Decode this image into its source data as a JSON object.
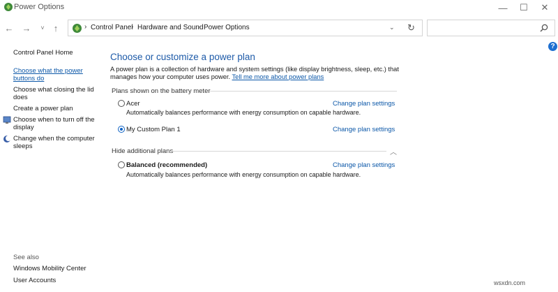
{
  "window": {
    "title": "Power Options",
    "minimize": "—",
    "maximize": "☐",
    "close": "✕"
  },
  "nav": {
    "back": "←",
    "forward": "→",
    "recent": "˅",
    "up": "↑"
  },
  "address": {
    "crumbs": [
      "Control Panel",
      "Hardware and Sound",
      "Power Options"
    ],
    "separator": "›",
    "dropdown": "⌄",
    "refresh": "↻"
  },
  "search": {
    "placeholder": ""
  },
  "help": "?",
  "left_pane": {
    "home": "Control Panel Home",
    "items": [
      {
        "line1": "Choose what the power",
        "line2": "buttons do"
      },
      {
        "line1": "Choose what closing the lid",
        "line2": "does"
      },
      {
        "line1": "Create a power plan"
      },
      {
        "line1": "Choose when to turn off the",
        "line2": "display"
      },
      {
        "line1": "Change when the computer",
        "line2": "sleeps"
      }
    ],
    "see_also": "See also",
    "see_also_links": [
      "Windows Mobility Center",
      "User Accounts"
    ]
  },
  "main": {
    "heading": "Choose or customize a power plan",
    "description": "A power plan is a collection of hardware and system settings (like display brightness, sleep, etc.) that manages how your computer uses power.",
    "tell_me_link": "Tell me more about power plans",
    "section_battery": "Plans shown on the battery meter",
    "section_hidden": "Hide additional plans",
    "plans": [
      {
        "name": "Acer",
        "description": "Automatically balances performance with energy consumption on capable hardware.",
        "selected": false,
        "link": "Change plan settings"
      },
      {
        "name": "My Custom Plan 1",
        "description": "",
        "selected": true,
        "link": "Change plan settings"
      },
      {
        "name": "Balanced (recommended)",
        "description": "Automatically balances performance with energy consumption on capable hardware.",
        "selected": false,
        "link": "Change plan settings"
      }
    ]
  },
  "watermark": "wsxdn.com"
}
